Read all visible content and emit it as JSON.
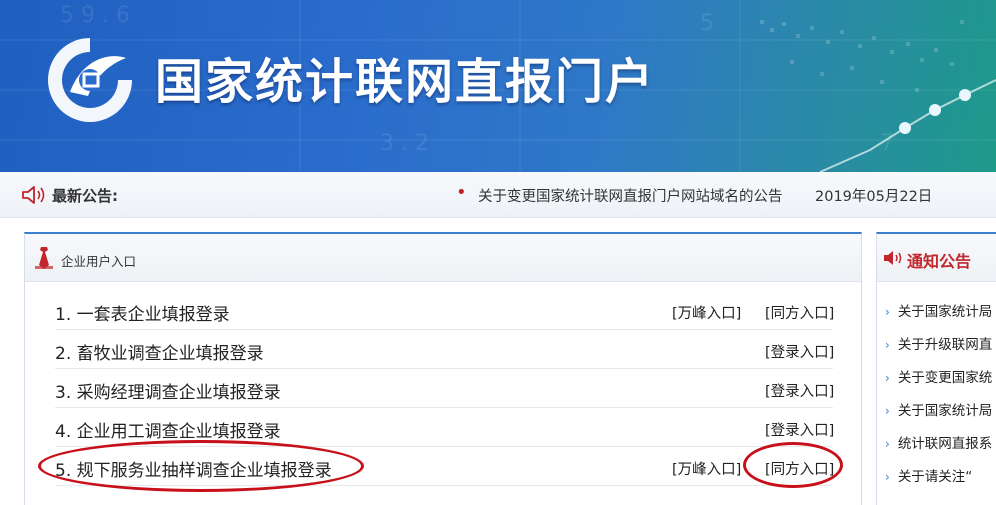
{
  "header": {
    "title": "国家统计联网直报门户"
  },
  "notice_bar": {
    "label": "最新公告:",
    "headline": "关于变更国家统计联网直报门户网站域名的公告",
    "date": "2019年05月22日"
  },
  "enterprise_panel": {
    "title": "企业用户入口",
    "rows": [
      {
        "text": "1.  一套表企业填报登录",
        "links": [
          "[万峰入口]",
          "[同方入口]"
        ]
      },
      {
        "text": "2.  畜牧业调查企业填报登录",
        "links": [
          "[登录入口]"
        ]
      },
      {
        "text": "3.  采购经理调查企业填报登录",
        "links": [
          "[登录入口]"
        ]
      },
      {
        "text": "4.  企业用工调查企业填报登录",
        "links": [
          "[登录入口]"
        ]
      },
      {
        "text": "5.  规下服务业抽样调查企业填报登录",
        "links": [
          "[万峰入口]",
          "[同方入口]"
        ]
      }
    ]
  },
  "notice_panel": {
    "title": "通知公告",
    "items": [
      "关于国家统计局",
      "关于升级联网直",
      "关于变更国家统",
      "关于国家统计局",
      "统计联网直报系",
      "关于请关注“"
    ]
  },
  "colors": {
    "banner_blue": "#2a6ccc",
    "accent_red": "#c0262c",
    "annotation_red": "#c8101a",
    "panel_accent": "#3b7fd0"
  }
}
